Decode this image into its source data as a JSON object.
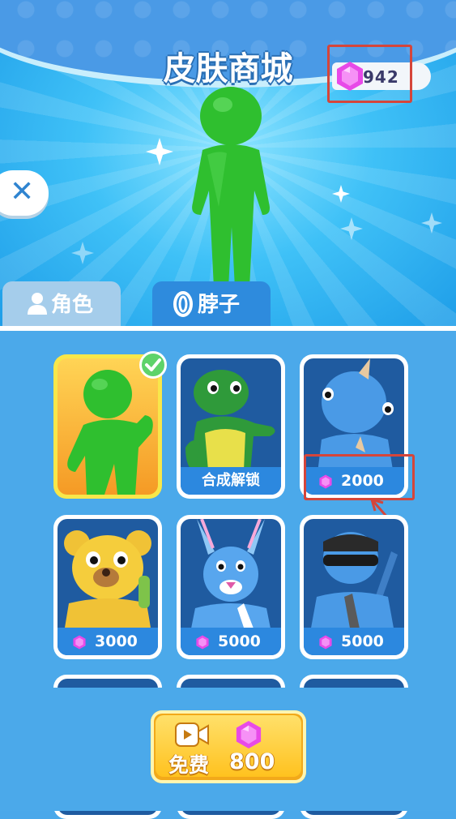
{
  "header": {
    "title": "皮肤商城",
    "gems": "942"
  },
  "tabs": [
    {
      "label": "角色",
      "icon": "person-icon",
      "active": false
    },
    {
      "label": "脖子",
      "icon": "ring-icon",
      "active": true
    }
  ],
  "skins": [
    {
      "name": "green-stickman",
      "selected": true
    },
    {
      "name": "turtle",
      "action": "合成解锁"
    },
    {
      "name": "blue-dino",
      "price": "2000"
    },
    {
      "name": "bear",
      "price": "3000"
    },
    {
      "name": "bunny",
      "price": "5000"
    },
    {
      "name": "ninja",
      "price": "5000"
    }
  ],
  "free_button": {
    "label": "免费",
    "value": "800",
    "icon": "video-icon"
  },
  "colors": {
    "accent": "#2e8bdd",
    "gem": "#e84ae8",
    "button": "#ffc21f",
    "highlight": "#d5453a"
  }
}
